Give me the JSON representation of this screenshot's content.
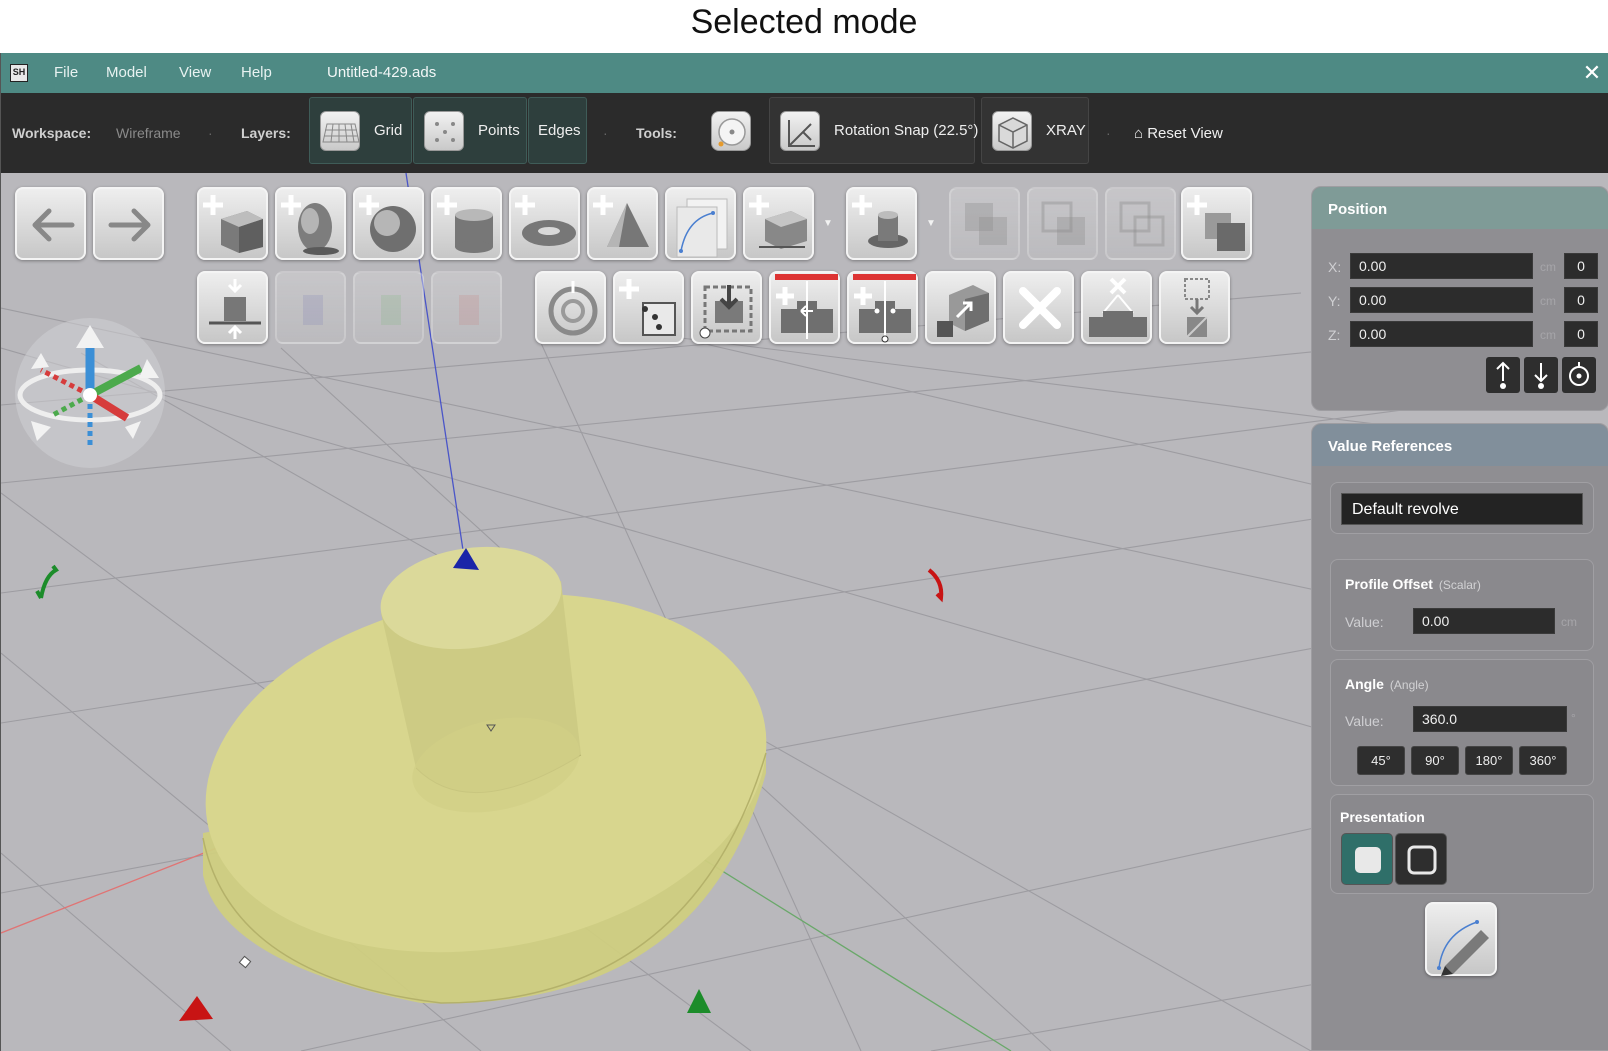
{
  "caption": "Selected mode",
  "titlebar": {
    "logo": "SH",
    "menus": [
      "File",
      "Model",
      "View",
      "Help"
    ],
    "document": "Untitled-429.ads",
    "close": "✕"
  },
  "toolbar": {
    "workspace_label": "Workspace:",
    "workspace_value": "Wireframe",
    "layers_label": "Layers:",
    "layers": [
      {
        "label": "Grid",
        "active": true
      },
      {
        "label": "Points",
        "active": true
      },
      {
        "label": "Edges",
        "active": true
      }
    ],
    "tools_label": "Tools:",
    "rotation_snap": "Rotation Snap (22.5°)",
    "xray": "XRAY",
    "reset_view": "⌂ Reset View"
  },
  "position": {
    "title": "Position",
    "rows": [
      {
        "axis": "X:",
        "value": "0.00",
        "unit": "cm",
        "step": "0"
      },
      {
        "axis": "Y:",
        "value": "0.00",
        "unit": "cm",
        "step": "0"
      },
      {
        "axis": "Z:",
        "value": "0.00",
        "unit": "cm",
        "step": "0"
      }
    ]
  },
  "value_references": {
    "title": "Value References",
    "selected": "Default revolve",
    "profile_offset": {
      "title": "Profile Offset",
      "type": "(Scalar)",
      "label": "Value:",
      "value": "0.00",
      "unit": "cm"
    },
    "angle": {
      "title": "Angle",
      "type": "(Angle)",
      "label": "Value:",
      "value": "360.0",
      "unit": "°",
      "presets": [
        "45°",
        "90°",
        "180°",
        "360°"
      ]
    },
    "presentation": {
      "title": "Presentation"
    }
  },
  "colors": {
    "titlebar": "#4e8a84",
    "toolbar": "#2b2b2b",
    "viewport": "#b9b8bc",
    "solid": "#d6d48a",
    "accent": "#2f6f69"
  }
}
